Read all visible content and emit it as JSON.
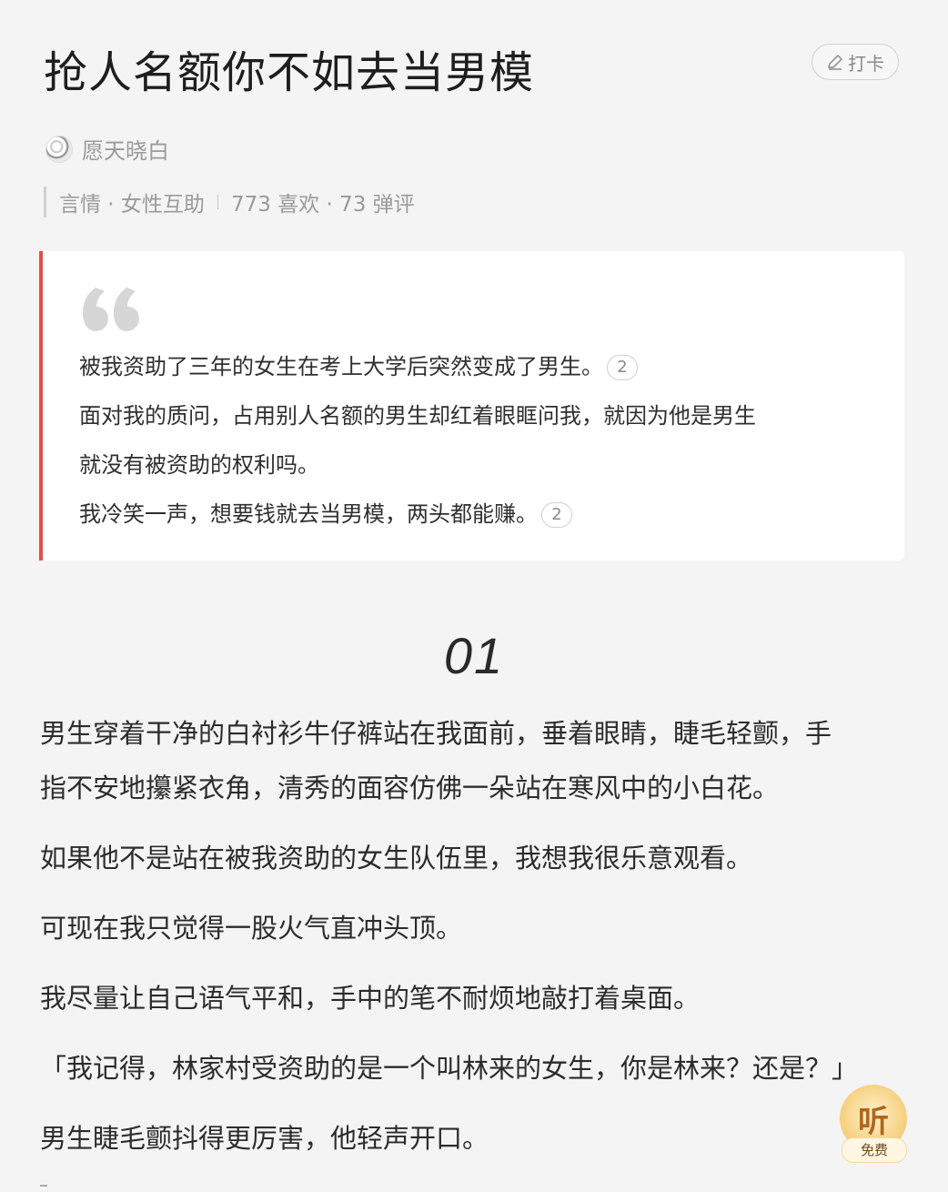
{
  "header": {
    "title": "抢人名额你不如去当男模",
    "checkin_label": "打卡"
  },
  "author": {
    "name": "愿天晓白"
  },
  "meta": {
    "category": "言情 · 女性互助",
    "stats": "773  喜欢 · 73  弹评"
  },
  "summary": {
    "lines": [
      {
        "text": "被我资助了三年的女生在考上大学后突然变成了男生。",
        "comments": "2"
      },
      {
        "text": "面对我的质问，占用别人名额的男生却红着眼眶问我，就因为他是男生",
        "comments": ""
      },
      {
        "text": "就没有被资助的权利吗。",
        "comments": ""
      },
      {
        "text": "我冷笑一声，想要钱就去当男模，两头都能赚。",
        "comments": "2"
      }
    ]
  },
  "chapter": {
    "number": "01"
  },
  "paragraphs": [
    {
      "lines": [
        "男生穿着干净的白衬衫牛仔裤站在我面前，垂着眼睛，睫毛轻颤，手",
        "指不安地攥紧衣角，清秀的面容仿佛一朵站在寒风中的小白花。"
      ]
    },
    {
      "lines": [
        "如果他不是站在被我资助的女生队伍里，我想我很乐意观看。"
      ]
    },
    {
      "lines": [
        "可现在我只觉得一股火气直冲头顶。"
      ]
    },
    {
      "lines": [
        "我尽量让自己语气平和，手中的笔不耐烦地敲打着桌面。"
      ]
    },
    {
      "lines": [
        "「我记得，林家村受资助的是一个叫林来的女生，你是林来？还是？」"
      ]
    },
    {
      "lines": [
        "男生睫毛颤抖得更厉害，他轻声开口。"
      ]
    }
  ],
  "listen": {
    "label": "听",
    "tag": "免费"
  },
  "colors": {
    "accent_red": "#e94b4b",
    "gold": "#f7d58a"
  },
  "icons": [
    "pen-icon",
    "quote-icon"
  ]
}
